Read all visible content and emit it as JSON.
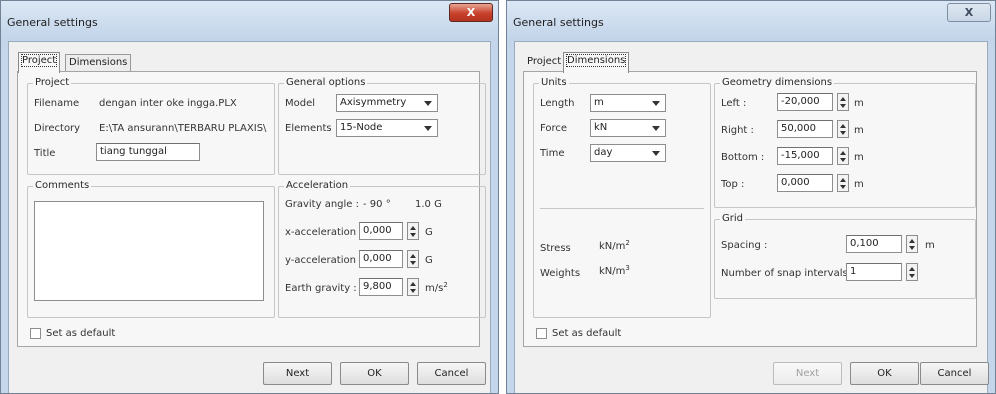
{
  "left_dialog": {
    "title": "General settings",
    "close_label": "X",
    "tabs": [
      {
        "label": "Project"
      },
      {
        "label": "Dimensions"
      }
    ],
    "project_group": {
      "legend": "Project",
      "filename_label": "Filename",
      "filename_value": "dengan inter oke ingga.PLX",
      "directory_label": "Directory",
      "directory_value": "E:\\TA ansurann\\TERBARU PLAXIS\\",
      "title_label": "Title",
      "title_value": "tiang tunggal"
    },
    "general_options": {
      "legend": "General options",
      "model_label": "Model",
      "model_value": "Axisymmetry",
      "elements_label": "Elements",
      "elements_value": "15-Node"
    },
    "comments": {
      "legend": "Comments",
      "value": ""
    },
    "acceleration": {
      "legend": "Acceleration",
      "gravity_angle_label": "Gravity angle :",
      "gravity_angle_value": "- 90 °",
      "gravity_g_value": "1.0 G",
      "x_accel_label": "x-acceleration :",
      "x_accel_value": "0,000",
      "x_accel_unit": "G",
      "y_accel_label": "y-acceleration :",
      "y_accel_value": "0,000",
      "y_accel_unit": "G",
      "earth_gravity_label": "Earth gravity :",
      "earth_gravity_value": "9,800",
      "earth_gravity_unit": "m/s",
      "earth_gravity_unit_sup": "2"
    },
    "set_default_label": "Set as default",
    "buttons": {
      "next": "Next",
      "ok": "OK",
      "cancel": "Cancel"
    }
  },
  "right_dialog": {
    "title": "General settings",
    "close_label": "X",
    "tabs": [
      {
        "label": "Project"
      },
      {
        "label": "Dimensions"
      }
    ],
    "units": {
      "legend": "Units",
      "length_label": "Length",
      "length_value": "m",
      "force_label": "Force",
      "force_value": "kN",
      "time_label": "Time",
      "time_value": "day",
      "stress_label": "Stress",
      "stress_value": "kN/m",
      "stress_sup": "2",
      "weights_label": "Weights",
      "weights_value": "kN/m",
      "weights_sup": "3"
    },
    "geometry": {
      "legend": "Geometry dimensions",
      "left_label": "Left :",
      "left_value": "-20,000",
      "right_label": "Right :",
      "right_value": "50,000",
      "bottom_label": "Bottom :",
      "bottom_value": "-15,000",
      "top_label": "Top :",
      "top_value": "0,000",
      "unit": "m"
    },
    "grid": {
      "legend": "Grid",
      "spacing_label": "Spacing :",
      "spacing_value": "0,100",
      "spacing_unit": "m",
      "snap_label": "Number of snap intervals:",
      "snap_value": "1"
    },
    "set_default_label": "Set as default",
    "buttons": {
      "next": "Next",
      "ok": "OK",
      "cancel": "Cancel"
    }
  }
}
